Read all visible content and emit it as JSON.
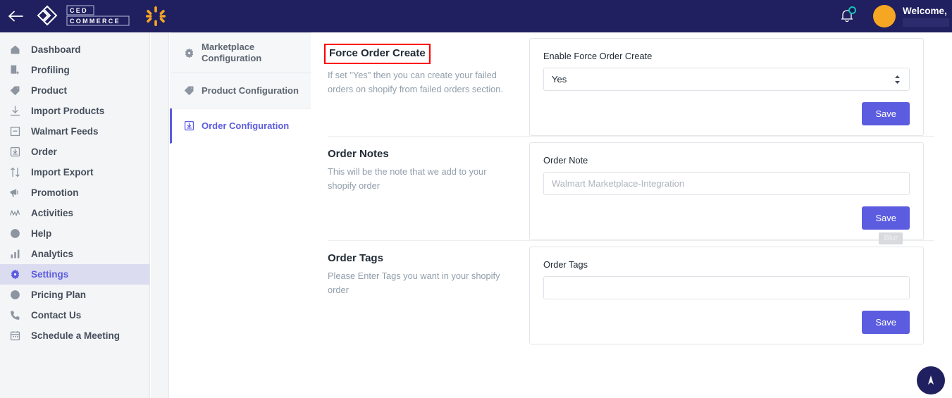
{
  "header": {
    "back_icon": "arrow-left-icon",
    "brand": {
      "logo_icon": "cedcommerce-logo",
      "line1": "CED",
      "line2": "COMMERCE",
      "marketplace_icon": "walmart-spark-icon"
    },
    "bell_icon": "notification-bell-icon",
    "avatar_icon": "user-avatar",
    "welcome_text": "Welcome,",
    "accent_color": "#202060",
    "badge_color": "#17c0b8"
  },
  "sidebar": {
    "items": [
      {
        "label": "Dashboard",
        "icon": "home-icon",
        "active": false
      },
      {
        "label": "Profiling",
        "icon": "profile-add-icon",
        "active": false
      },
      {
        "label": "Product",
        "icon": "tag-icon",
        "active": false
      },
      {
        "label": "Import Products",
        "icon": "download-icon",
        "active": false
      },
      {
        "label": "Walmart Feeds",
        "icon": "inbox-icon",
        "active": false
      },
      {
        "label": "Order",
        "icon": "order-box-icon",
        "active": false
      },
      {
        "label": "Import Export",
        "icon": "arrows-updown-icon",
        "active": false
      },
      {
        "label": "Promotion",
        "icon": "megaphone-icon",
        "active": false
      },
      {
        "label": "Activities",
        "icon": "activity-pulse-icon",
        "active": false
      },
      {
        "label": "Help",
        "icon": "question-circle-icon",
        "active": false
      },
      {
        "label": "Analytics",
        "icon": "bar-chart-icon",
        "active": false
      },
      {
        "label": "Settings",
        "icon": "gear-icon",
        "active": true
      },
      {
        "label": "Pricing Plan",
        "icon": "dollar-circle-icon",
        "active": false
      },
      {
        "label": "Contact Us",
        "icon": "phone-icon",
        "active": false
      },
      {
        "label": "Schedule a Meeting",
        "icon": "calendar-icon",
        "active": false
      }
    ],
    "active_color": "#5c5ce0"
  },
  "tabs": [
    {
      "label": "Marketplace Configuration",
      "icon": "gear-icon",
      "selected": false
    },
    {
      "label": "Product Configuration",
      "icon": "tag-icon",
      "selected": false
    },
    {
      "label": "Order Configuration",
      "icon": "order-box-icon",
      "selected": true
    }
  ],
  "sections": [
    {
      "title": "Force Order Create",
      "description": "If set \"Yes\" then you can create your failed orders on shopify from failed orders section.",
      "field_label": "Enable Force Order Create",
      "control": "select",
      "value": "Yes",
      "placeholder": "",
      "save_label": "Save",
      "highlighted": true
    },
    {
      "title": "Order Notes",
      "description": "This will be the note that we add to your shopify order",
      "field_label": "Order Note",
      "control": "text",
      "value": "",
      "placeholder": "Walmart Marketplace-Integration",
      "save_label": "Save",
      "highlighted": false
    },
    {
      "title": "Order Tags",
      "description": "Please Enter Tags you want in your shopify order",
      "field_label": "Order Tags",
      "control": "text",
      "value": "",
      "placeholder": "",
      "save_label": "Save",
      "highlighted": false,
      "badge": "Blur"
    }
  ],
  "fab": {
    "icon": "navigate-up-icon"
  }
}
